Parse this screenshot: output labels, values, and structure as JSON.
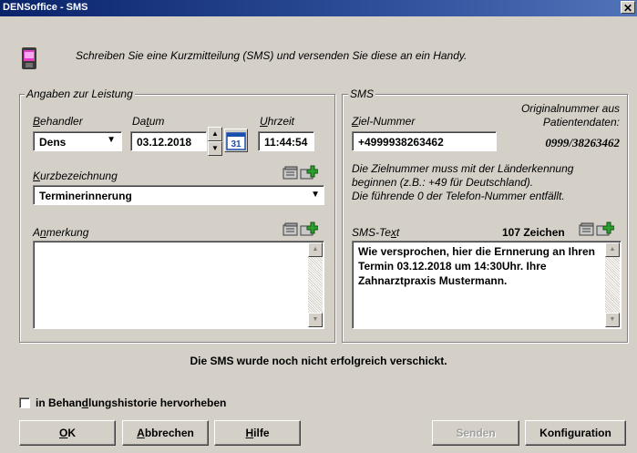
{
  "window": {
    "title": "DENSoffice - SMS",
    "close_glyph": "✕",
    "intro": "Schreiben Sie eine Kurzmitteilung (SMS) und versenden Sie diese an ein Handy."
  },
  "leistung": {
    "legend": "Angaben zur Leistung",
    "behandler": {
      "label_pre": "",
      "label_ul": "B",
      "label_post": "ehandler",
      "value": "Dens"
    },
    "datum": {
      "label_pre": "Da",
      "label_ul": "t",
      "label_post": "um",
      "value": "03.12.2018",
      "calendar_day": "31"
    },
    "uhrzeit": {
      "label_pre": "",
      "label_ul": "U",
      "label_post": "hrzeit",
      "value": "11:44:54"
    },
    "kurzbezeichnung": {
      "label_pre": "",
      "label_ul": "K",
      "label_post": "urzbezeichnung",
      "value": "Terminerinnerung"
    },
    "anmerkung": {
      "label_pre": "A",
      "label_ul": "n",
      "label_post": "merkung",
      "value": ""
    }
  },
  "sms": {
    "legend": "SMS",
    "original_label": "Originalnummer aus\nPatientendaten:",
    "original_number": "0999/38263462",
    "ziel": {
      "label_pre": "",
      "label_ul": "Z",
      "label_post": "iel-Nummer",
      "value": "+4999938263462"
    },
    "hint": "Die Zielnummer muss mit der Länderkennung\nbeginnen (z.B.: +49 für Deutschland).\nDie führende 0 der Telefon-Nummer entfällt.",
    "text_label_pre": "SMS-Te",
    "text_label_ul": "x",
    "text_label_post": "t",
    "char_count": "107 Zeichen",
    "text_value": "Wie versprochen, hier die Ernnerung an Ihren Termin 03.12.2018 um 14:30Uhr. Ihre Zahnarztpraxis Mustermann."
  },
  "status": "Die SMS wurde noch nicht erfolgreich verschickt.",
  "highlight_checkbox": {
    "label_pre": "in Behan",
    "label_ul": "d",
    "label_post": "lungshistorie hervorheben",
    "checked": false
  },
  "buttons": {
    "ok": {
      "pre": "",
      "ul": "O",
      "post": "K"
    },
    "abbrechen": {
      "pre": "",
      "ul": "A",
      "post": "bbrechen"
    },
    "hilfe": {
      "pre": "",
      "ul": "H",
      "post": "ilfe"
    },
    "senden": "Senden",
    "konfiguration": "Konfiguration"
  },
  "icons": {
    "window_icon": "sms-phone-icon",
    "library": "text-library-icon",
    "add": "add-text-icon",
    "calendar": "calendar-icon"
  },
  "colors": {
    "title_gradient_start": "#0a246a",
    "title_gradient_end": "#5173b8",
    "dialog_bg": "#d4d0c8"
  }
}
